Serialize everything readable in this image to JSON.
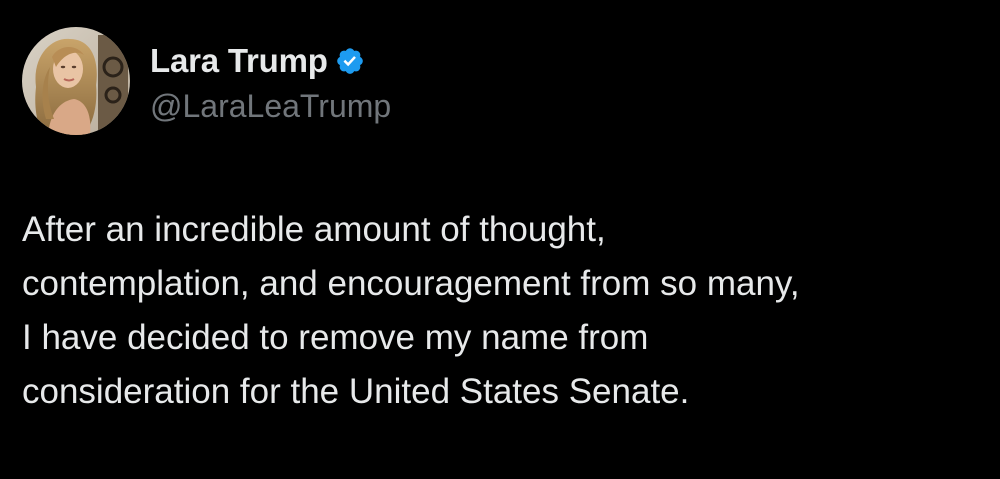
{
  "tweet": {
    "author": {
      "display_name": "Lara Trump",
      "handle": "@LaraLeaTrump",
      "verified": true,
      "avatar_icon": "profile-photo"
    },
    "text_lines": [
      "After an incredible amount of thought,",
      "contemplation, and encouragement from so many,",
      "I have decided to remove my name from",
      "consideration for the United States Senate."
    ]
  },
  "colors": {
    "background": "#000000",
    "text_primary": "#e7e9ea",
    "text_secondary": "#71767b",
    "verified_badge": "#1d9bf0"
  }
}
